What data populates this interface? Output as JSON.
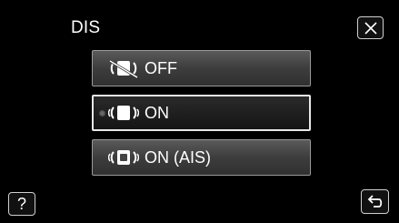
{
  "header": {
    "title": "DIS"
  },
  "options": [
    {
      "label": "OFF",
      "icon": "stabilizer-off-icon",
      "selected": false
    },
    {
      "label": "ON",
      "icon": "stabilizer-on-icon",
      "selected": true
    },
    {
      "label": "ON (AIS)",
      "icon": "stabilizer-ais-icon",
      "selected": false
    }
  ],
  "buttons": {
    "close_icon": "close-icon",
    "help_label": "?",
    "back_icon": "return-icon"
  },
  "colors": {
    "background": "#000000",
    "button_border": "#cfcfcf",
    "selected_border": "#e8e8e8"
  }
}
